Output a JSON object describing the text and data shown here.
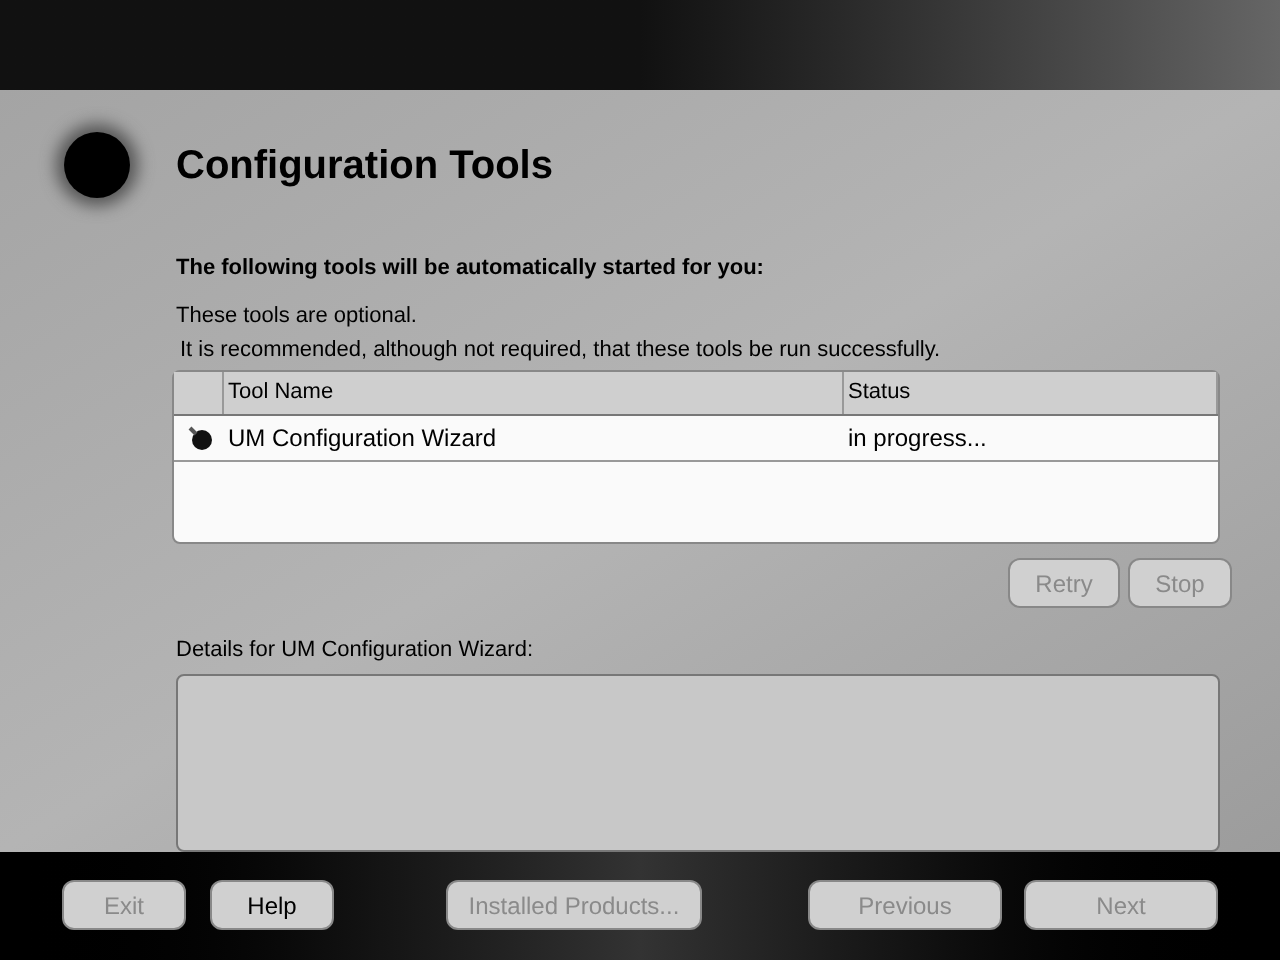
{
  "header": {
    "title": "Configuration Tools"
  },
  "intro": {
    "heading": "The following tools will be automatically started for you:",
    "lines": [
      "These tools are optional.",
      "It is recommended, although not required, that these tools be run successfully."
    ]
  },
  "table": {
    "columns": [
      "Tool Name",
      "Status"
    ],
    "rows": [
      {
        "name": "UM Configuration Wizard",
        "status": "in progress..."
      }
    ]
  },
  "table_buttons": [
    {
      "label": "Retry",
      "disabled": true
    },
    {
      "label": "Stop",
      "disabled": true
    }
  ],
  "details": {
    "label": "Details for UM Configuration Wizard:"
  },
  "footer": {
    "left": [
      {
        "label": "Exit",
        "disabled": true
      },
      {
        "label": "Help",
        "disabled": false
      }
    ],
    "middle": [
      {
        "label": "Installed Products...",
        "disabled": true
      }
    ],
    "right": [
      {
        "label": "Previous",
        "disabled": true
      },
      {
        "label": "Next",
        "disabled": true
      }
    ]
  }
}
